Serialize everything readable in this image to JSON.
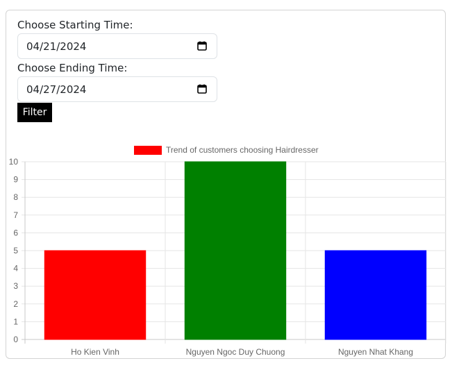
{
  "form": {
    "start_label": "Choose Starting Time:",
    "start_value": "04/21/2024",
    "end_label": "Choose Ending Time:",
    "end_value": "04/27/2024",
    "filter_label": "Filter",
    "calendar_icon": "calendar-icon"
  },
  "chart_data": {
    "type": "bar",
    "legend_position": "top-center",
    "grid": true,
    "ylim": [
      0,
      10
    ],
    "yticks": [
      0,
      1,
      2,
      3,
      4,
      5,
      6,
      7,
      8,
      9,
      10
    ],
    "categories": [
      "Ho Kien Vinh",
      "Nguyen Ngoc Duy Chuong",
      "Nguyen Nhat Khang"
    ],
    "series": [
      {
        "name": "Trend of customers choosing Hairdresser",
        "values": [
          5,
          10,
          5
        ],
        "colors": [
          "#ff0000",
          "#008000",
          "#0000ff"
        ]
      }
    ]
  }
}
